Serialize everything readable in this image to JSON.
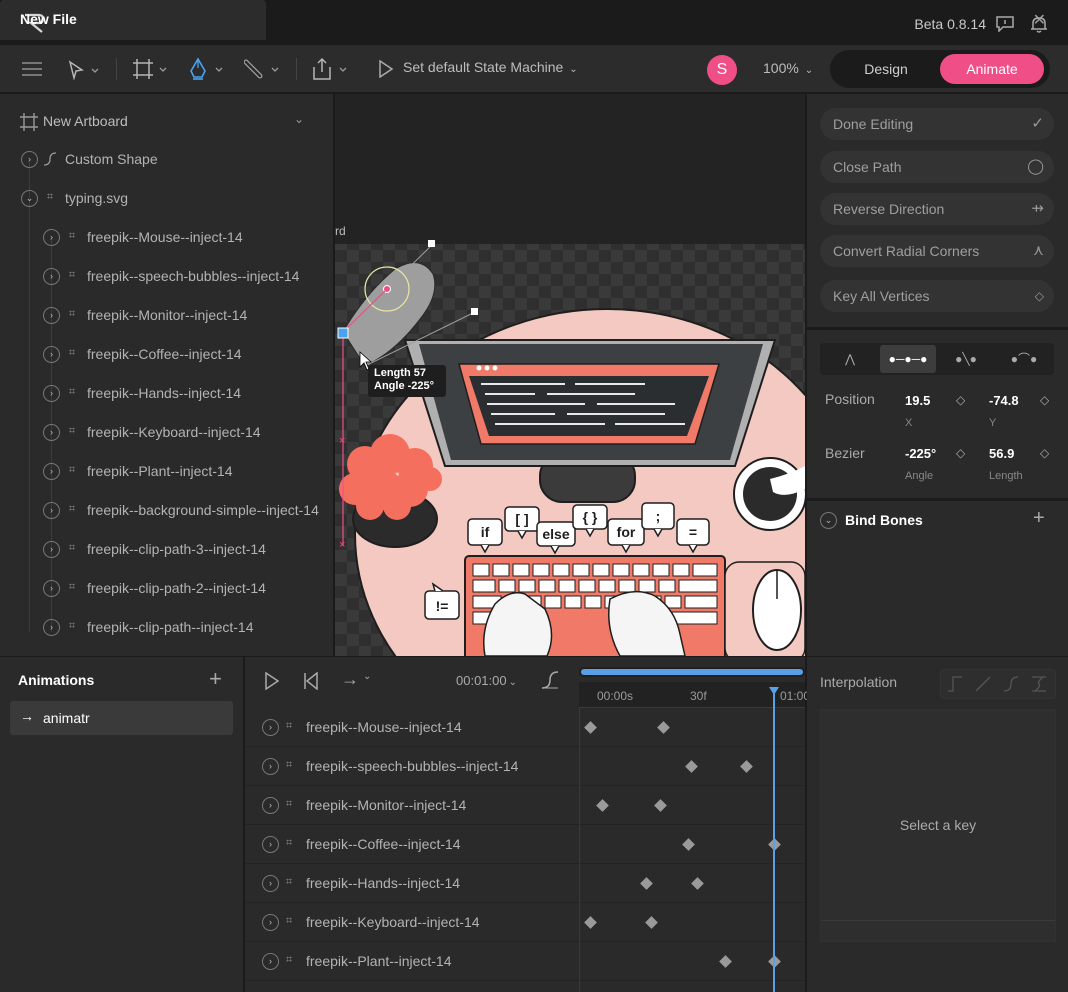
{
  "app": {
    "file_tab": "New File",
    "version": "Beta 0.8.14"
  },
  "toolbar": {
    "state_machine_label": "Set default State Machine",
    "avatar_initial": "S",
    "zoom": "100%",
    "mode_design": "Design",
    "mode_animate": "Animate"
  },
  "hierarchy": {
    "artboard": "New Artboard",
    "custom_shape": "Custom Shape",
    "svg_group": "typing.svg",
    "items": [
      "freepik--Mouse--inject-14",
      "freepik--speech-bubbles--inject-14",
      "freepik--Monitor--inject-14",
      "freepik--Coffee--inject-14",
      "freepik--Hands--inject-14",
      "freepik--Keyboard--inject-14",
      "freepik--Plant--inject-14",
      "freepik--background-simple--inject-14",
      "freepik--clip-path-3--inject-14",
      "freepik--clip-path-2--inject-14",
      "freepik--clip-path--inject-14"
    ]
  },
  "canvas": {
    "artboard_label_fragment": "rd",
    "tooltip_length": "Length 57",
    "tooltip_angle": "Angle -225°",
    "code_bubbles": [
      "if",
      "[ ]",
      "else",
      "{ }",
      "for",
      ";",
      "=",
      "!="
    ]
  },
  "path_tools": {
    "done_editing": "Done Editing",
    "close_path": "Close Path",
    "reverse_direction": "Reverse Direction",
    "convert_radial_corners": "Convert Radial Corners",
    "key_all_vertices": "Key All Vertices"
  },
  "vertex": {
    "position_label": "Position",
    "x_value": "19.5",
    "x_sub": "X",
    "y_value": "-74.8",
    "y_sub": "Y",
    "bezier_label": "Bezier",
    "angle_value": "-225°",
    "angle_sub": "Angle",
    "length_value": "56.9",
    "length_sub": "Length"
  },
  "bind_bones": {
    "title": "Bind Bones"
  },
  "animations": {
    "title": "Animations",
    "items": [
      "animatr"
    ]
  },
  "timeline": {
    "duration": "00:01:00",
    "ruler": [
      "00:00s",
      "30f",
      "01:00"
    ],
    "rows": [
      "freepik--Mouse--inject-14",
      "freepik--speech-bubbles--inject-14",
      "freepik--Monitor--inject-14",
      "freepik--Coffee--inject-14",
      "freepik--Hands--inject-14",
      "freepik--Keyboard--inject-14",
      "freepik--Plant--inject-14"
    ]
  },
  "interpolation": {
    "title": "Interpolation",
    "empty_message": "Select a key"
  },
  "colors": {
    "accent": "#ef4f86",
    "playhead": "#5aa0e6",
    "panel": "#2a2a2a",
    "background": "#1b1b1b"
  }
}
